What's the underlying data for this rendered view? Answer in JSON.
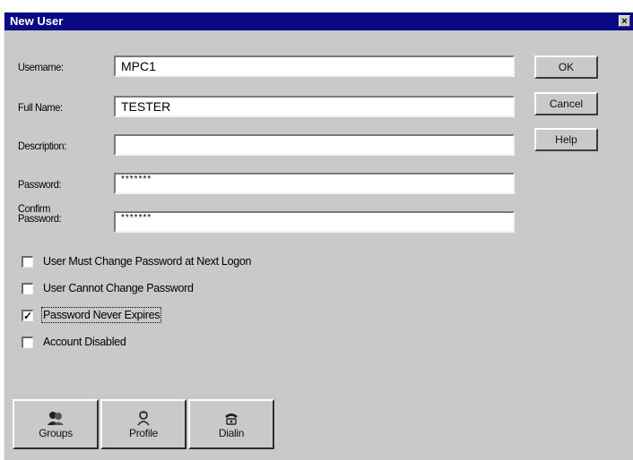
{
  "window": {
    "title": "New User",
    "close_glyph": "×",
    "colors": {
      "titlebar": "#0a0a84",
      "face": "#c9c9c9"
    }
  },
  "fields": [
    {
      "label": "Username:",
      "value": "MPC1"
    },
    {
      "label": "Full Name:",
      "value": "TESTER"
    },
    {
      "label": "Description:",
      "value": ""
    },
    {
      "label": "Password:",
      "value": "*******"
    },
    {
      "label_line1": "Confirm",
      "label_line2": "Password:",
      "value": "*******"
    }
  ],
  "buttons": {
    "ok": "OK",
    "cancel": "Cancel",
    "help": "Help"
  },
  "checkboxes": [
    {
      "label": "User Must Change Password at Next Logon",
      "checked": false
    },
    {
      "label": "User Cannot Change Password",
      "checked": false
    },
    {
      "label": "Password Never Expires",
      "checked": true
    },
    {
      "label": "Account Disabled",
      "checked": false
    }
  ],
  "check_glyph": "✓",
  "bottom_buttons": [
    {
      "label": "Groups",
      "icon": "groups-icon"
    },
    {
      "label": "Profile",
      "icon": "profile-icon"
    },
    {
      "label": "Dialin",
      "icon": "dialin-icon"
    }
  ]
}
